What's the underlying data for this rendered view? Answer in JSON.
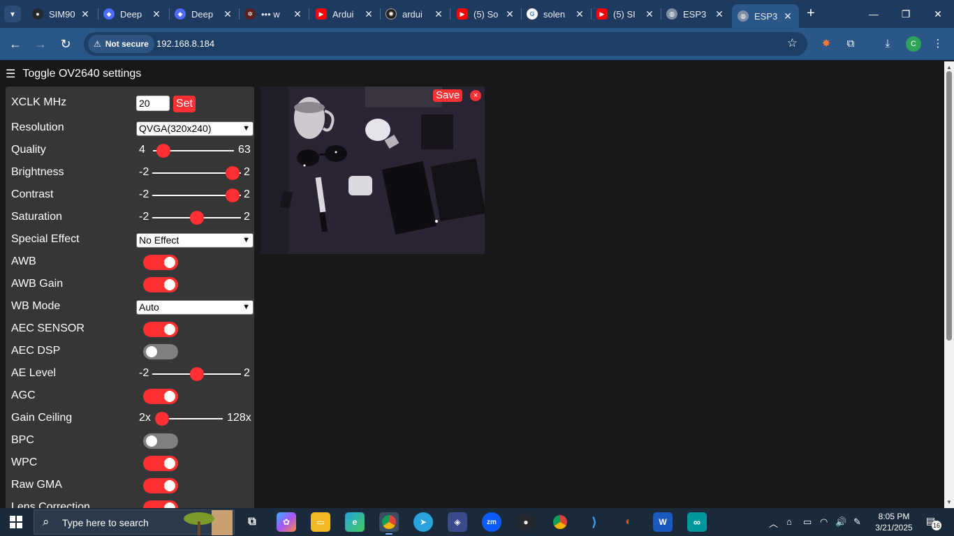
{
  "browser": {
    "tabs": [
      {
        "title": "SIM90",
        "icon": "github-icon",
        "color": "#24292f"
      },
      {
        "title": "Deep",
        "icon": "deepseek-icon",
        "color": "#4d6bfe"
      },
      {
        "title": "Deep",
        "icon": "deepseek-icon",
        "color": "#4d6bfe"
      },
      {
        "title": "••• w",
        "icon": "circuit-icon",
        "color": "#d9534f"
      },
      {
        "title": "Ardui",
        "icon": "youtube-icon",
        "color": "#ff0000"
      },
      {
        "title": "ardui",
        "icon": "chatgpt-icon",
        "color": "#202020"
      },
      {
        "title": "(5) So",
        "icon": "youtube-icon",
        "color": "#ff0000"
      },
      {
        "title": "solen",
        "icon": "google-icon",
        "color": "#ffffff"
      },
      {
        "title": "(5) SI",
        "icon": "youtube-icon",
        "color": "#ff0000"
      },
      {
        "title": "ESP3",
        "icon": "globe-icon",
        "color": "#7e8fa6"
      },
      {
        "title": "ESP3",
        "icon": "globe-icon",
        "color": "#7e8fa6",
        "active": true
      }
    ],
    "address": {
      "security": "Not secure",
      "url": "192.168.8.184"
    },
    "profile_initial": "C"
  },
  "page": {
    "toggle_label": "Toggle OV2640 settings",
    "xclk": {
      "label": "XCLK MHz",
      "value": "20",
      "button": "Set"
    },
    "resolution": {
      "label": "Resolution",
      "value": "QVGA(320x240)"
    },
    "sliders": {
      "quality": {
        "label": "Quality",
        "min": "4",
        "max": "63",
        "value": 10
      },
      "brightness": {
        "label": "Brightness",
        "min": "-2",
        "max": "2",
        "value": 2
      },
      "contrast": {
        "label": "Contrast",
        "min": "-2",
        "max": "2",
        "value": 2
      },
      "saturation": {
        "label": "Saturation",
        "min": "-2",
        "max": "2",
        "value": 0
      },
      "ae_level": {
        "label": "AE Level",
        "min": "-2",
        "max": "2",
        "value": 0
      },
      "gain_ceiling": {
        "label": "Gain Ceiling",
        "min": "2x",
        "max": "128x",
        "value": 0
      }
    },
    "special_effect": {
      "label": "Special Effect",
      "value": "No Effect"
    },
    "wb_mode": {
      "label": "WB Mode",
      "value": "Auto"
    },
    "toggles": {
      "awb": {
        "label": "AWB",
        "on": true
      },
      "awb_gain": {
        "label": "AWB Gain",
        "on": true
      },
      "aec_sensor": {
        "label": "AEC SENSOR",
        "on": true
      },
      "aec_dsp": {
        "label": "AEC DSP",
        "on": false
      },
      "agc": {
        "label": "AGC",
        "on": true
      },
      "bpc": {
        "label": "BPC",
        "on": false
      },
      "wpc": {
        "label": "WPC",
        "on": true
      },
      "raw_gma": {
        "label": "Raw GMA",
        "on": true
      },
      "lens_correction": {
        "label": "Lens Correction",
        "on": true
      }
    },
    "stream": {
      "save_label": "Save",
      "close_label": "×"
    }
  },
  "taskbar": {
    "search_placeholder": "Type here to search",
    "time": "8:05 PM",
    "date": "3/21/2025",
    "notification_count": "16"
  },
  "colors": {
    "accent": "#ff3034",
    "panel": "#363636",
    "background": "#181818"
  }
}
